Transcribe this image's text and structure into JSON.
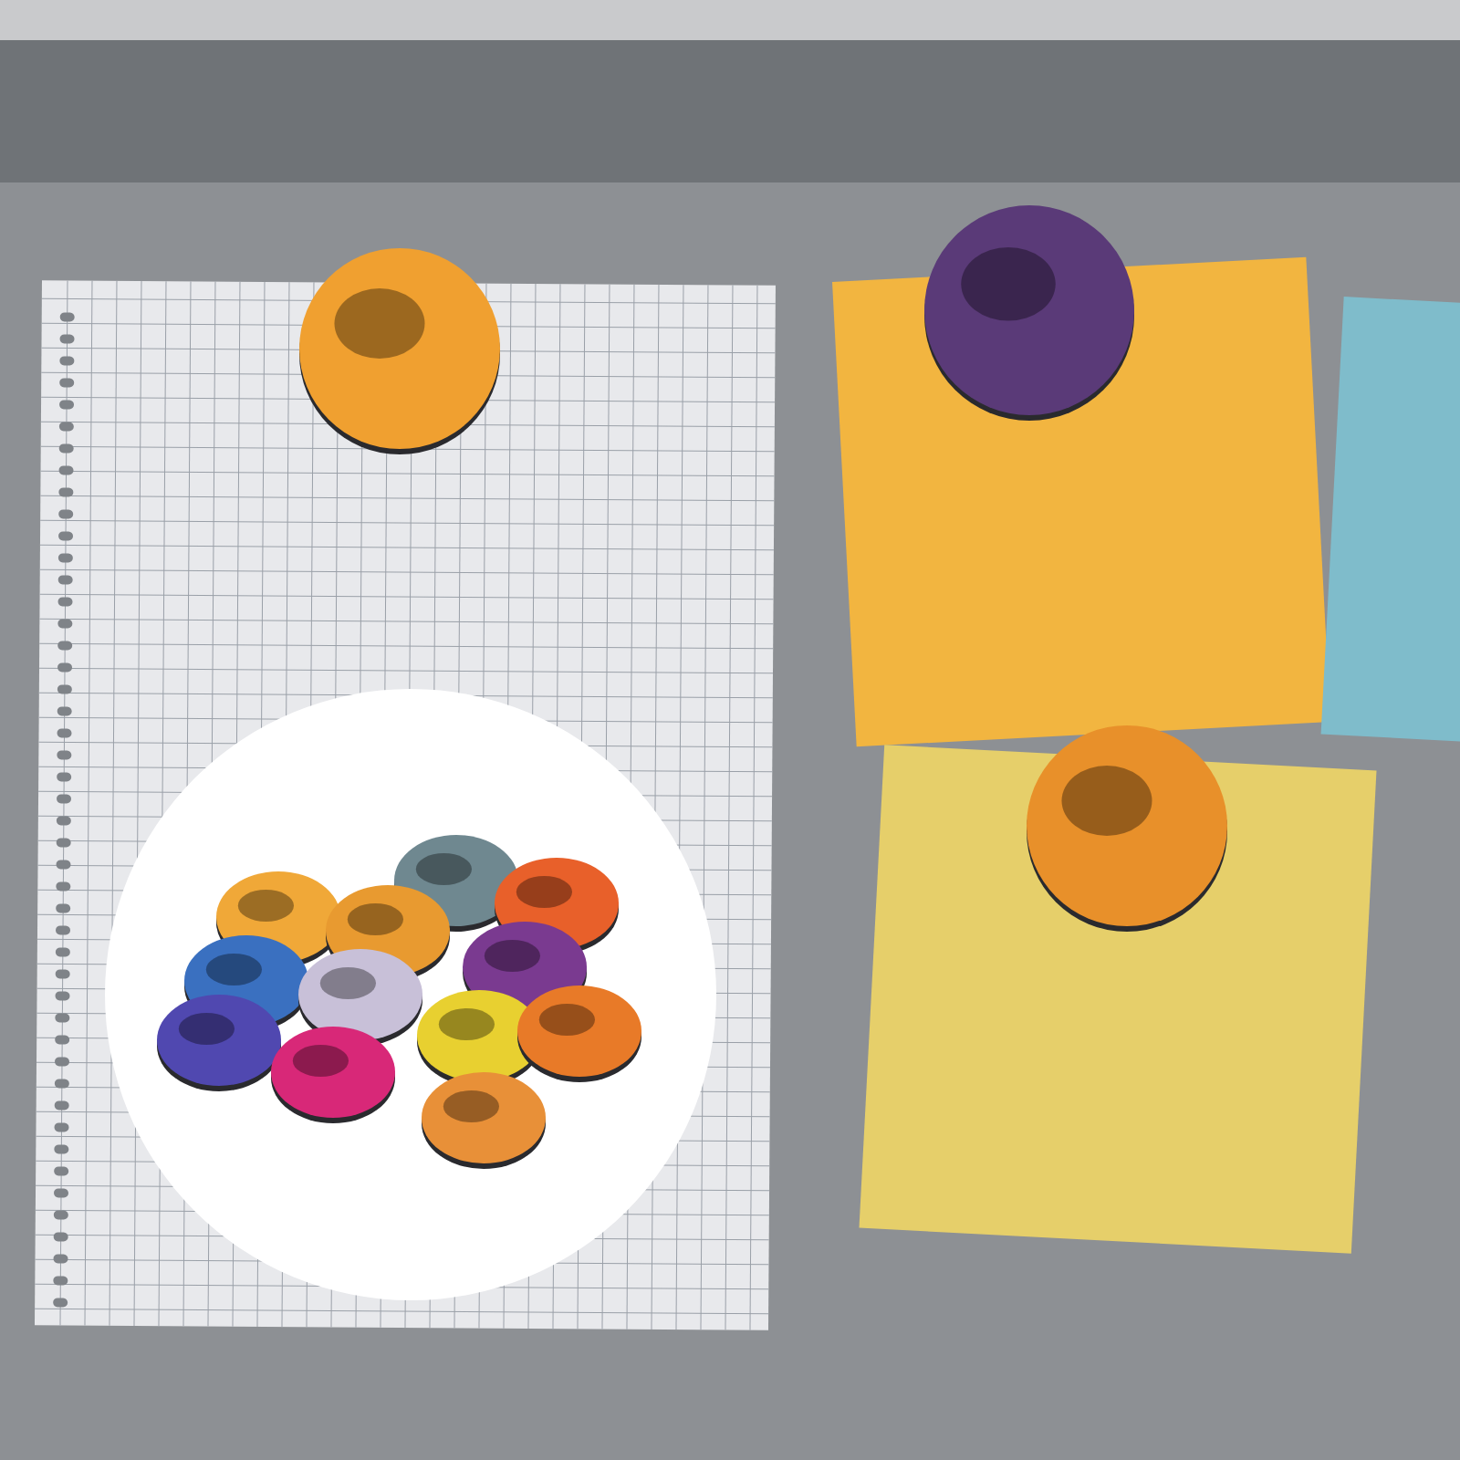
{
  "sticky_notes": [
    {
      "color": "#f2b540"
    },
    {
      "color": "#e6cf6a"
    },
    {
      "color": "#7fbccb"
    }
  ],
  "magnets": [
    {
      "kind": "large",
      "color": "#f0a030"
    },
    {
      "kind": "large",
      "color": "#5a3a78"
    },
    {
      "kind": "large",
      "color": "#e8902a"
    },
    {
      "kind": "small",
      "color": "#6f8890"
    },
    {
      "kind": "small",
      "color": "#f0a838"
    },
    {
      "kind": "small",
      "color": "#e8602a"
    },
    {
      "kind": "small",
      "color": "#e89a30"
    },
    {
      "kind": "small",
      "color": "#7a3a90"
    },
    {
      "kind": "small",
      "color": "#3a70c0"
    },
    {
      "kind": "small",
      "color": "#c8c0d8"
    },
    {
      "kind": "small",
      "color": "#e8d030"
    },
    {
      "kind": "small",
      "color": "#e87a28"
    },
    {
      "kind": "small",
      "color": "#5048b0"
    },
    {
      "kind": "small",
      "color": "#d82878"
    },
    {
      "kind": "small",
      "color": "#e89038"
    }
  ]
}
